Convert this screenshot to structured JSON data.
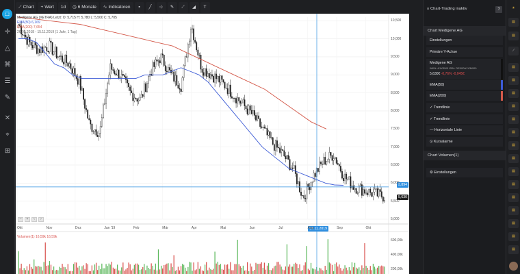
{
  "toolbar": {
    "chart_label": "Chart",
    "wert_label": "Wert",
    "interval_label": "1d",
    "range_label": "6 Monate",
    "indicators_label": "Indikatoren"
  },
  "chart": {
    "legend_main": "Medigene AG (XETRA)  Letzt: O: 5,715  H: 5,780  L: 5,500  C: 5,705",
    "legend_ema50": "EMA(50)  6,169",
    "legend_ema200": "EMA(200)  7,654",
    "legend_period": "26.09.2018 - 15.11.2019  (1 Jahr, 1 Tag)",
    "crosshair_price": "5,894",
    "last_price": "5,630",
    "crosshair_date": "01.11.2019",
    "volume_legend": "Volumen(1)  16,59k  16,59k",
    "y_labels": [
      "10,500",
      "10,000",
      "9,500",
      "9,000",
      "8,500",
      "8,000",
      "7,500",
      "7,000",
      "6,500",
      "6,000",
      "5,500",
      "5,000"
    ],
    "x_labels": [
      "Okt",
      "Nov",
      "Dez",
      "Jan '19",
      "Feb",
      "Mär",
      "Apr",
      "Mai",
      "Jun",
      "Jul",
      "Aug",
      "Sep",
      "Okt"
    ],
    "vol_labels": [
      "600,00k",
      "400,00k",
      "200,00k"
    ],
    "colors": {
      "ema50": "#3c5bd6",
      "ema200": "#d4594a",
      "candle": "#222222",
      "crosshair": "#2f8fe0",
      "vol_up": "#5cb85c",
      "vol_down": "#d9534f"
    }
  },
  "chart_data": {
    "type": "line",
    "title": "Medigene AG",
    "xlabel": "",
    "ylabel": "",
    "ylim": [
      5.0,
      10.6
    ],
    "series": [
      {
        "name": "Medigene AG",
        "values": [
          10.4,
          9.9,
          9.7,
          9.8,
          9.5,
          9.3,
          8.8,
          7.6,
          7.4,
          9.2,
          9.0,
          8.5,
          8.3,
          9.1,
          9.5,
          9.0,
          8.7,
          10.4,
          9.2,
          9.0,
          8.8,
          8.5,
          8.2,
          7.9,
          7.5,
          7.1,
          6.8,
          6.4,
          5.6,
          6.2,
          6.6,
          6.8,
          6.2,
          5.9,
          5.8,
          5.7,
          5.63
        ]
      },
      {
        "name": "EMA(50)",
        "values": [
          10.0,
          10.0,
          9.9,
          9.6,
          9.3,
          9.2,
          9.0,
          8.9,
          8.9,
          8.9,
          8.9,
          8.9,
          8.9,
          8.9,
          9.0,
          9.0,
          9.0,
          9.1,
          9.2,
          9.1,
          9.0,
          8.8,
          8.5,
          8.2,
          7.9,
          7.6,
          7.3,
          7.0,
          6.8,
          6.6,
          6.4,
          6.3,
          6.2,
          6.1,
          6.0,
          5.95,
          5.94
        ]
      },
      {
        "name": "EMA(200)",
        "values": [
          10.6,
          10.55,
          10.5,
          10.45,
          10.4,
          10.3,
          10.2,
          10.1,
          10.0,
          9.9,
          9.8,
          9.6,
          9.4,
          9.2,
          9.0,
          8.8,
          8.6,
          8.3,
          8.0,
          7.7,
          7.5
        ]
      }
    ]
  },
  "panel": {
    "header": "Chart-Trading inaktiv",
    "help": "?",
    "section_title": "Chart Medigene AG",
    "items": [
      {
        "label": "Einstellungen"
      },
      {
        "label": "Primäre Y-Achse"
      },
      {
        "label": "Medigene AG"
      },
      {
        "label": "EMA(50)"
      },
      {
        "label": "EMA(200)"
      },
      {
        "label": "✓ Trendlinie"
      },
      {
        "label": "✓ Trendlinie"
      },
      {
        "label": "— Horizontale Linie"
      },
      {
        "label": "⊙ Kursalarme"
      }
    ],
    "instrument_wkn": "WKN: A1X3W0  ISIN: DE000A1X3W00",
    "instrument_price": "5,630€",
    "instrument_change": "-0,76%  -0,045€",
    "volume_section": "Chart Volumen(1)",
    "volume_settings": "⚙ Einstellungen"
  }
}
